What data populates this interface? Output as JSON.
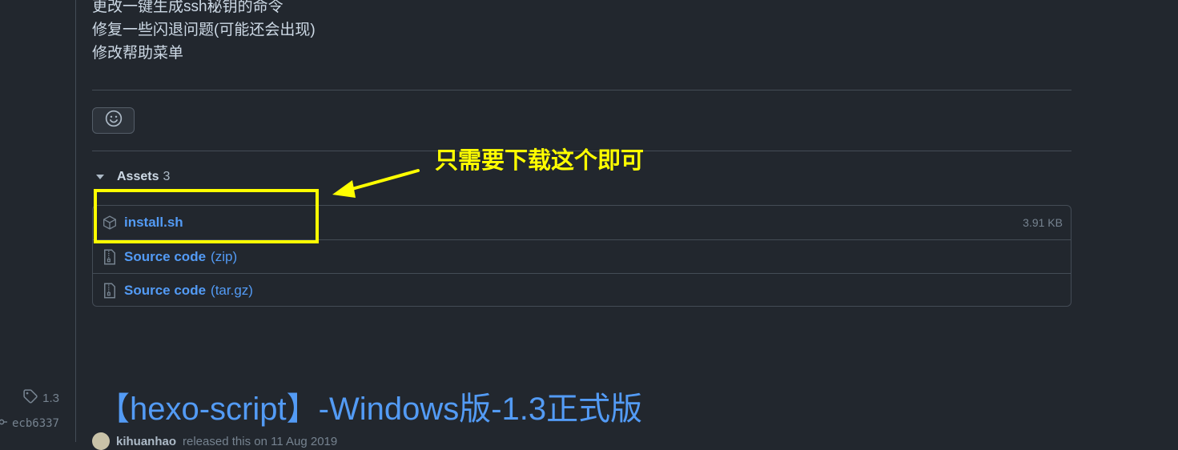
{
  "release_notes": {
    "lines": [
      "更改一键生成ssh秘钥的命令",
      "修复一些闪退问题(可能还会出现)",
      "修改帮助菜单"
    ]
  },
  "reaction_button": {
    "icon": "smiley-icon"
  },
  "assets": {
    "label": "Assets",
    "count": "3",
    "items": [
      {
        "icon": "package-icon",
        "name": "install.sh",
        "detail": "",
        "size": "3.91 KB"
      },
      {
        "icon": "file-zip-icon",
        "name": "Source code",
        "detail": "(zip)",
        "size": ""
      },
      {
        "icon": "file-zip-icon",
        "name": "Source code",
        "detail": "(tar.gz)",
        "size": ""
      }
    ]
  },
  "annotation": {
    "callout": "只需要下载这个即可",
    "color": "#ffff00"
  },
  "sidebar": {
    "tag": "1.3",
    "commit": "ecb6337"
  },
  "next_release": {
    "title": "【hexo-script】-Windows版-1.3正式版",
    "author": "kihuanhao",
    "meta": "released this on 11 Aug 2019"
  },
  "colors": {
    "background": "#22272e",
    "link": "#539bf5",
    "border": "#444c56",
    "muted": "#768390"
  }
}
